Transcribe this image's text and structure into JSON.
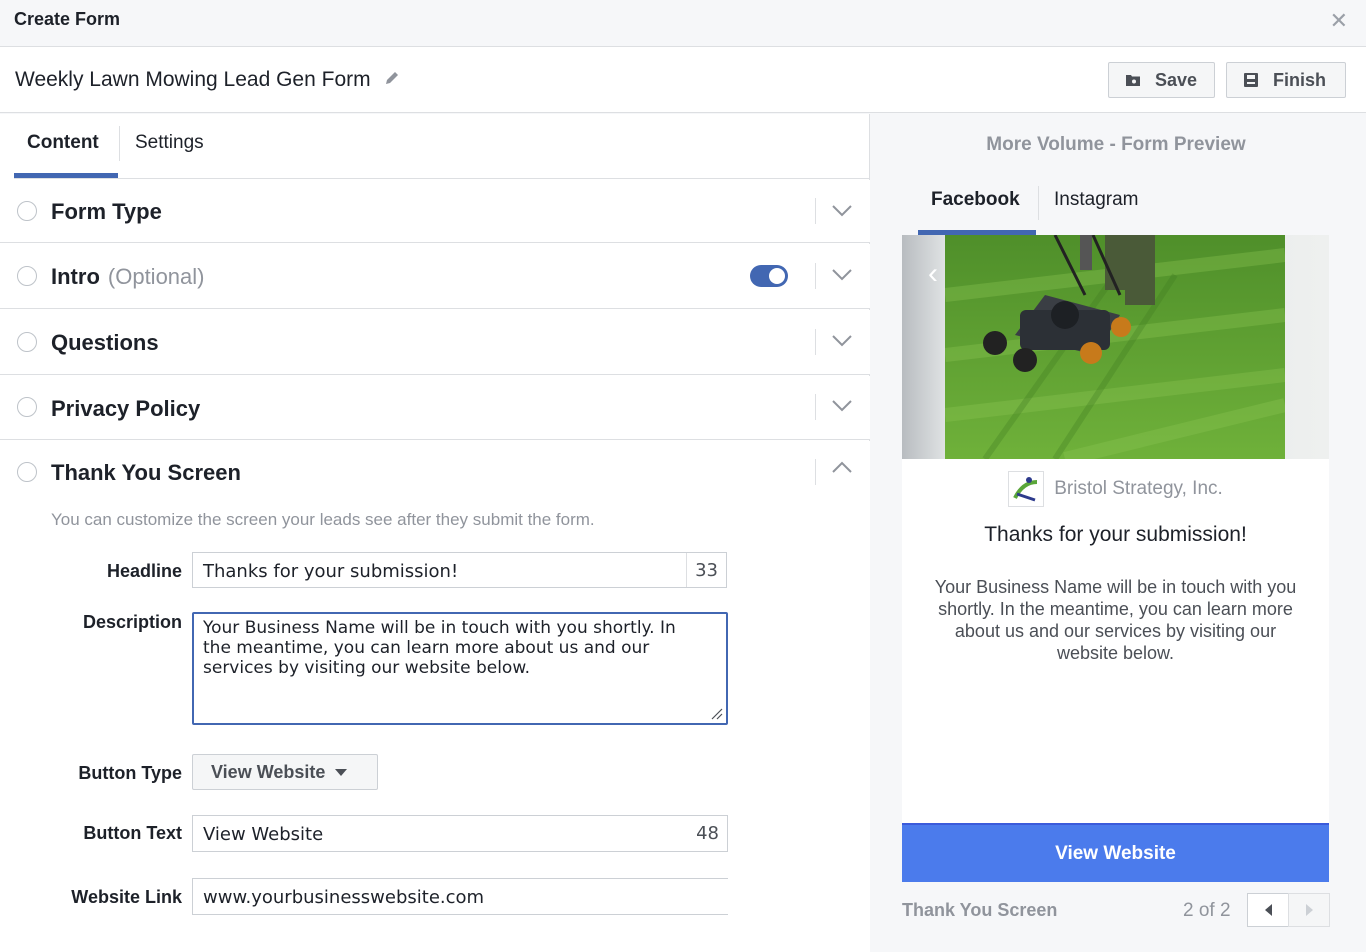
{
  "dialog": {
    "title": "Create Form"
  },
  "form": {
    "name": "Weekly Lawn Mowing Lead Gen Form"
  },
  "toolbar": {
    "save_label": "Save",
    "finish_label": "Finish"
  },
  "tabs": {
    "content": "Content",
    "settings": "Settings"
  },
  "sections": {
    "form_type": "Form Type",
    "intro": "Intro",
    "intro_optional": "(Optional)",
    "questions": "Questions",
    "privacy_policy": "Privacy Policy",
    "thank_you": "Thank You Screen"
  },
  "thank_you": {
    "help_text": "You can customize the screen your leads see after they submit the form.",
    "headline_label": "Headline",
    "headline_value": "Thanks for your submission!",
    "headline_count": "33",
    "description_label": "Description",
    "description_value": "Your Business Name will be in touch with you shortly. In the meantime, you can learn more about us and our services by visiting our website below.",
    "button_type_label": "Button Type",
    "button_type_value": "View Website",
    "button_text_label": "Button Text",
    "button_text_value": "View Website",
    "button_text_count": "48",
    "website_link_label": "Website Link",
    "website_link_value": "www.yourbusinesswebsite.com"
  },
  "preview": {
    "title": "More Volume - Form Preview",
    "tab_facebook": "Facebook",
    "tab_instagram": "Instagram",
    "business_name": "Bristol Strategy, Inc.",
    "headline": "Thanks for your submission!",
    "description": "Your Business Name will be in touch with you shortly. In the meantime, you can learn more about us and our services by visiting our website below.",
    "button": "View Website",
    "screen_label": "Thank You Screen",
    "pager": "2 of 2"
  },
  "colors": {
    "accent": "#4267b2",
    "preview_button": "#4b7bec"
  }
}
